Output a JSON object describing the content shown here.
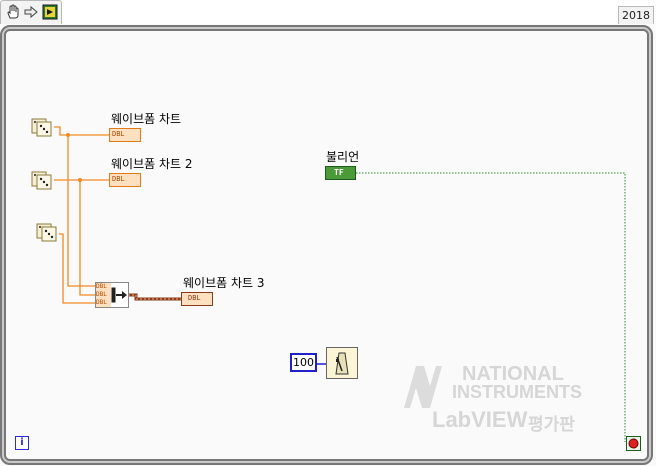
{
  "toolbar": {
    "icons": [
      "hand-tool-icon",
      "step-arrow-icon",
      "palette-icon"
    ]
  },
  "version": "2018",
  "diagram": {
    "charts": [
      {
        "label": "웨이브폼 차트",
        "terminal": "DBL"
      },
      {
        "label": "웨이브폼 차트 2",
        "terminal": "DBL"
      },
      {
        "label": "웨이브폼 차트 3",
        "terminal": "DBL"
      }
    ],
    "bundle_inputs": [
      "DBL",
      "DBL",
      "DBL"
    ],
    "boolean": {
      "label": "불리언",
      "terminal": "TF"
    },
    "wait_ms": "100",
    "iteration_terminal": "i",
    "random_number_icons": [
      "dice-icon",
      "dice-icon",
      "dice-icon"
    ],
    "stop_terminal": "stop-icon",
    "colors": {
      "numeric_wire": "#f08a24",
      "boolean_wire": "#2c8a2c",
      "cluster_wire": "#8b3b1b",
      "loop_border": "#7a7a7a",
      "int_constant": "#2020c8"
    }
  },
  "watermark": {
    "line1": "NATIONAL",
    "line2": "INSTRUMENTS",
    "line3": "LabVIEW",
    "line3_suffix": "평가판"
  }
}
